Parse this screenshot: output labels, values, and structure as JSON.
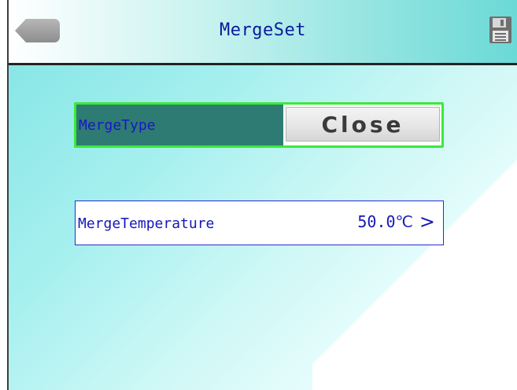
{
  "header": {
    "title": "MergeSet",
    "back_icon": "back-arrow-icon",
    "save_icon": "save-floppy-icon"
  },
  "merge_type": {
    "label": "MergeType",
    "value": "Close"
  },
  "merge_temperature": {
    "label": "MergeTemperature",
    "value": "50.0℃",
    "chevron": ">"
  },
  "colors": {
    "accent_green": "#3bea36",
    "text_blue": "#1a17c9",
    "label_bg": "#2e7b73"
  }
}
